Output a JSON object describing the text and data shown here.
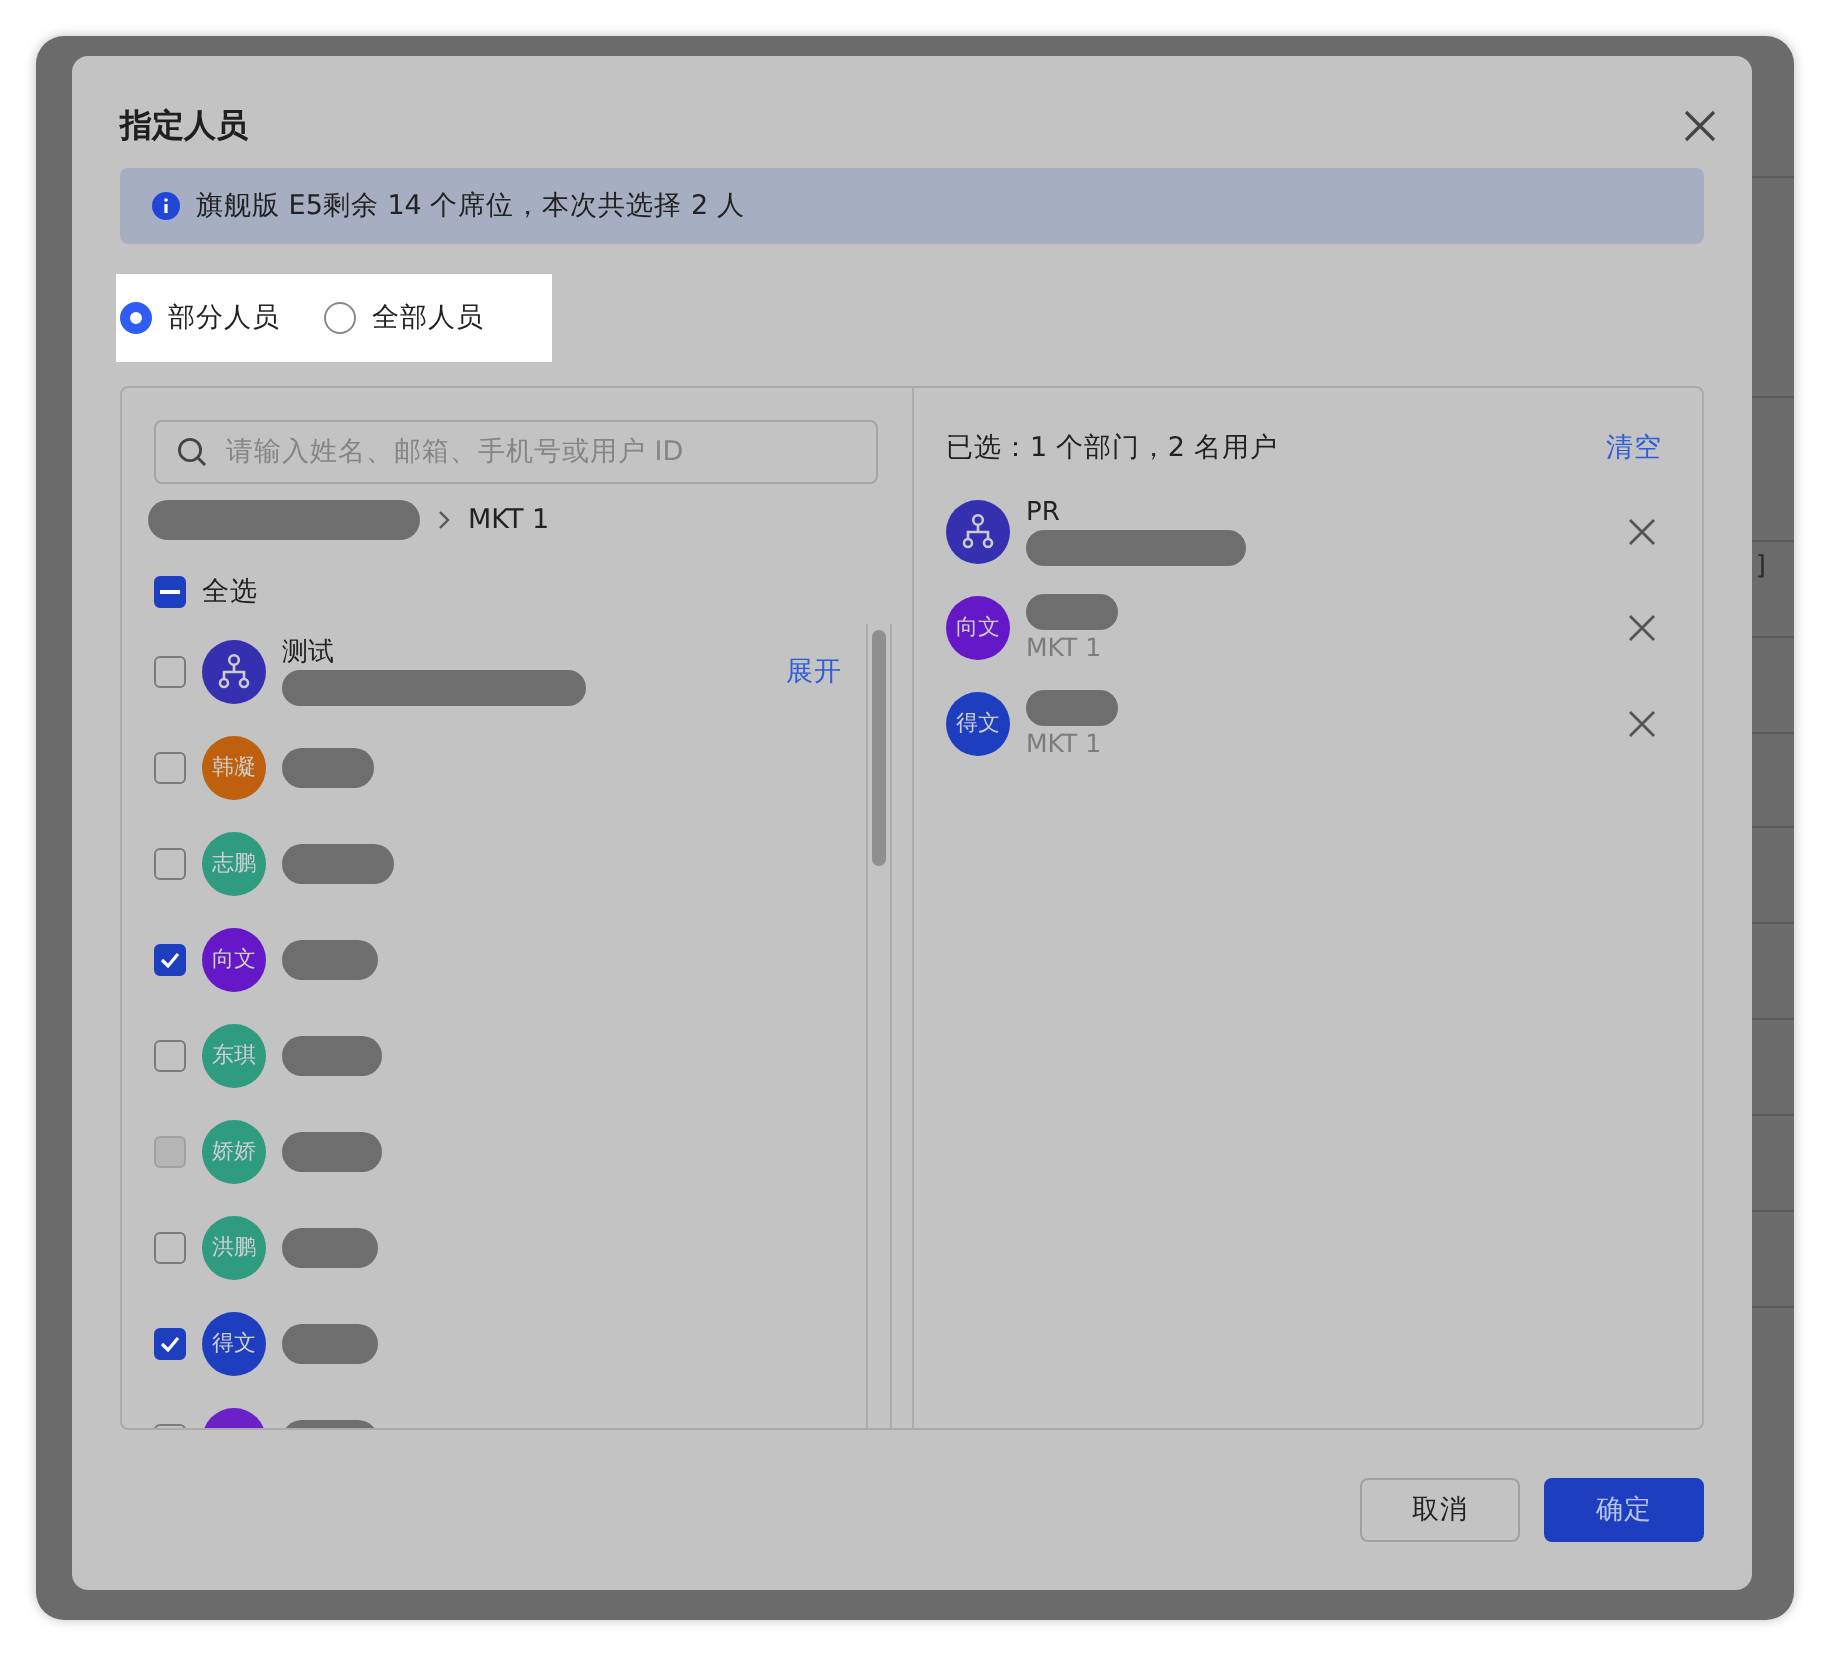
{
  "dialog": {
    "title": "指定人员",
    "notice": "旗舰版 E5剩余 14 个席位，本次共选择 2 人"
  },
  "scope_options": [
    {
      "label": "部分人员",
      "selected": true
    },
    {
      "label": "全部人员",
      "selected": false
    }
  ],
  "search": {
    "placeholder": "请输入姓名、邮箱、手机号或用户 ID"
  },
  "breadcrumb": {
    "path_redacted": true,
    "current": "MKT 1"
  },
  "select_all": {
    "label": "全选",
    "indeterminate": true
  },
  "members": [
    {
      "kind": "department",
      "name": "测试",
      "detail_redacted": true,
      "checked": false,
      "disabled": false,
      "action": "展开"
    },
    {
      "kind": "user",
      "avatar": "韩凝",
      "color": "#bf600f",
      "checked": false,
      "disabled": false
    },
    {
      "kind": "user",
      "avatar": "志鹏",
      "color": "#2f9c80",
      "checked": false,
      "disabled": false
    },
    {
      "kind": "user",
      "avatar": "向文",
      "color": "#6418c8",
      "checked": true,
      "disabled": false
    },
    {
      "kind": "user",
      "avatar": "东琪",
      "color": "#2f9c80",
      "checked": false,
      "disabled": false
    },
    {
      "kind": "user",
      "avatar": "娇娇",
      "color": "#2f9c80",
      "checked": false,
      "disabled": true
    },
    {
      "kind": "user",
      "avatar": "洪鹏",
      "color": "#2f9c80",
      "checked": false,
      "disabled": false
    },
    {
      "kind": "user",
      "avatar": "得文",
      "color": "#1e3ec0",
      "checked": true,
      "disabled": false
    },
    {
      "kind": "user",
      "color": "#6a22c8",
      "checked": false,
      "disabled": false
    }
  ],
  "selected_panel": {
    "summary": "已选：1 个部门，2 名用户",
    "clear": "清空",
    "items": [
      {
        "kind": "department",
        "name": "PR",
        "detail_redacted": true
      },
      {
        "kind": "user",
        "avatar": "向文",
        "color": "#6418c8",
        "detail": "MKT 1"
      },
      {
        "kind": "user",
        "avatar": "得文",
        "color": "#1e3ec0",
        "detail": "MKT 1"
      }
    ]
  },
  "buttons": [
    {
      "label": "取消",
      "kind": "secondary"
    },
    {
      "label": "确定",
      "kind": "primary"
    }
  ],
  "background_fragment": "]"
}
